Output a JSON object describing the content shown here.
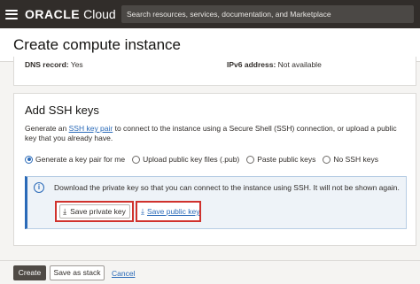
{
  "topbar": {
    "brand_oracle": "ORACLE",
    "brand_cloud": "Cloud",
    "search_placeholder": "Search resources, services, documentation, and Marketplace"
  },
  "header": {
    "title": "Create compute instance"
  },
  "info": {
    "dns_label": "DNS record:",
    "dns_value": "Yes",
    "ipv6_label": "IPv6 address:",
    "ipv6_value": "Not available"
  },
  "ssh": {
    "title": "Add SSH keys",
    "desc_prefix": "Generate an ",
    "desc_link": "SSH key pair",
    "desc_suffix": " to connect to the instance using a Secure Shell (SSH) connection, or upload a public key that you already have.",
    "options": [
      {
        "label": "Generate a key pair for me",
        "checked": true
      },
      {
        "label": "Upload public key files (.pub)",
        "checked": false
      },
      {
        "label": "Paste public keys",
        "checked": false
      },
      {
        "label": "No SSH keys",
        "checked": false
      }
    ],
    "notice_text": "Download the private key so that you can connect to the instance using SSH. It will not be shown again.",
    "save_private_label": "Save private key",
    "save_public_label": "Save public key"
  },
  "footer": {
    "create_label": "Create",
    "save_stack_label": "Save as stack",
    "cancel_label": "Cancel"
  },
  "colors": {
    "topbar": "#312d2a",
    "accent": "#2a6ab8",
    "highlight_border": "#d0322d"
  }
}
